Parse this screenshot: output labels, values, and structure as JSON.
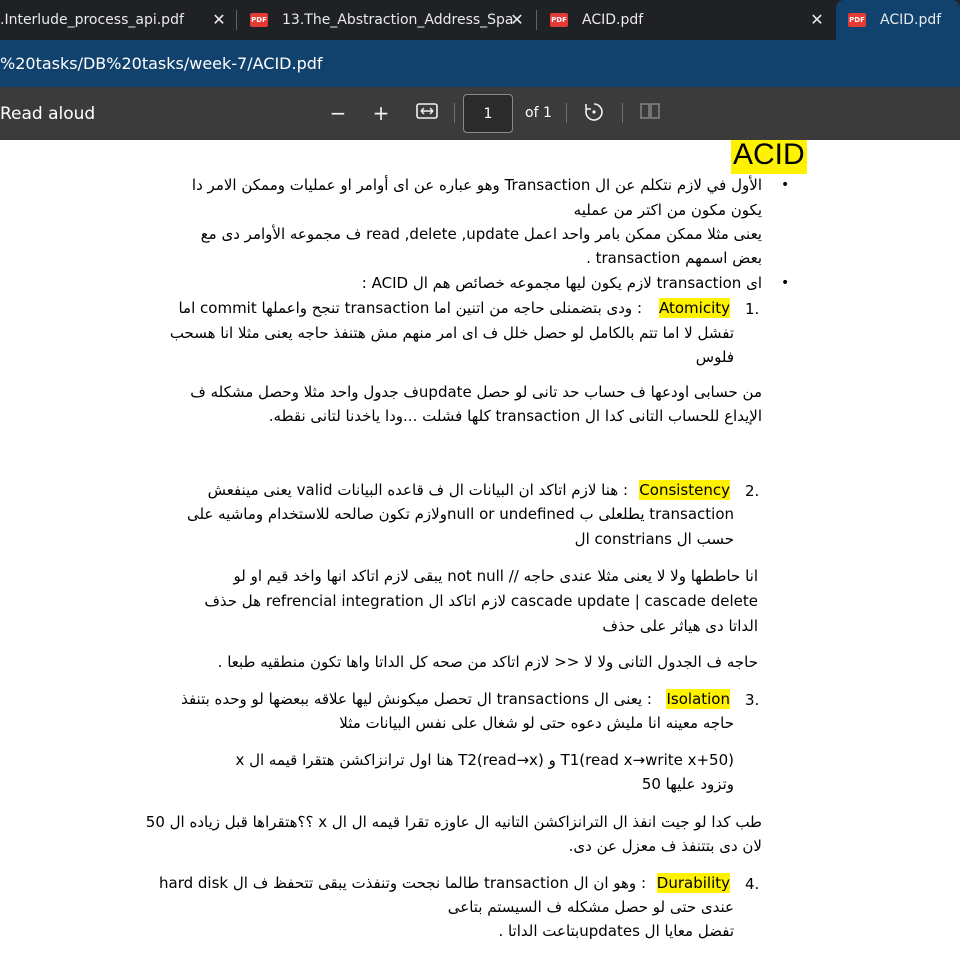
{
  "tabs": [
    {
      "label": ".Interlude_process_api.pdf"
    },
    {
      "label": "13.The_Abstraction_Address_Spa"
    },
    {
      "label": "ACID.pdf"
    },
    {
      "label": "ACID.pdf"
    }
  ],
  "tab_close_glyph": "✕",
  "pdf_badge": "PDF",
  "address": "%20tasks/DB%20tasks/week-7/ACID.pdf",
  "toolbar": {
    "read_aloud": "Read aloud",
    "page_number": "1",
    "of_pages": "of 1"
  },
  "doc": {
    "title": "ACID",
    "lines": [
      "الأول في لازم نتكلم عن ال  Transaction وهو عباره عن اى أوامر او عمليات  وممكن الامر دا",
      "يكون مكون من اكتر من عمليه",
      "يعنى مثلا ممكن ممكن بامر واحد اعمل  read ,delete ,update ف مجموعه الأوامر دى مع",
      "بعض اسمهم   transaction .",
      "اى transaction لازم يكون ليها مجموعه خصائص هم ال ACID :",
      ": ودى بتضمنلى حاجه من اتنين اما  transaction تنجح  واعملها  commit اما",
      "تفشل لا اما تتم بالكامل لو حصل خلل ف اى امر منهم مش هتنفذ حاجه  يعنى مثلا انا هسحب",
      "فلوس",
      "من حسابى اودعها ف حساب حد تانى لو حصل  updateف جدول واحد مثلا وحصل مشكله ف",
      "الإيداع للحساب التانى كدا ال  transaction كلها فشلت ...ودا ياخدنا لتانى نقطه.",
      ": هنا لازم اتاكد ان البيانات ال ف قاعده البيانات    valid يعنى مينفعش",
      "transaction يطلعلى ب null or undefinedولازم تكون صالحه للاستخدام  وماشيه على",
      "حسب ال constrians ال",
      "انا حاططها ولا لا يعنى مثلا  عندى حاجه // not null يبقى لازم اتاكد انها واخد قيم او لو",
      "cascade update | cascade delete لازم اتاكد ال  refrencial integration هل حذف",
      "الداتا دى هياثر على حذف",
      "حاجه ف الجدول التانى ولا لا  << لازم اتاكد من صحه كل الداتا واها تكون منطقيه طبعا .",
      ": يعنى ال  transactions ال تحصل ميكونش ليها علاقه ببعضها لو وحده بتنفذ",
      "حاجه معينه انا مليش دعوه حتى لو شغال على نفس البيانات مثلا",
      "T1(read x→write x+50)    و     T2(read→x)   هنا اول ترانزاكشن هتقرا قيمه ال  x",
      "وتزود عليها 50",
      "طب كدا لو جيت انفذ ال الترانزاكشن التانيه ال عاوزه تقرا قيمه ال ال x  ؟؟هتقراها قبل زياده ال 50",
      "لان دى بتتنفذ ف معزل عن دى.",
      ": وهو ان ال  transaction طالما نجحت وتنفذت يبقى تتحفظ ف ال hard disk",
      "عندى حتى لو حصل مشكله ف السيستم بتاعى",
      "تفضل معايا  ال  updatesبتاعت الداتا ."
    ],
    "terms": [
      "Atomicity",
      "Consistency",
      "Isolation",
      "Durability"
    ],
    "numbers": [
      "1.",
      "2.",
      "3.",
      "4."
    ],
    "bullet": "•"
  }
}
